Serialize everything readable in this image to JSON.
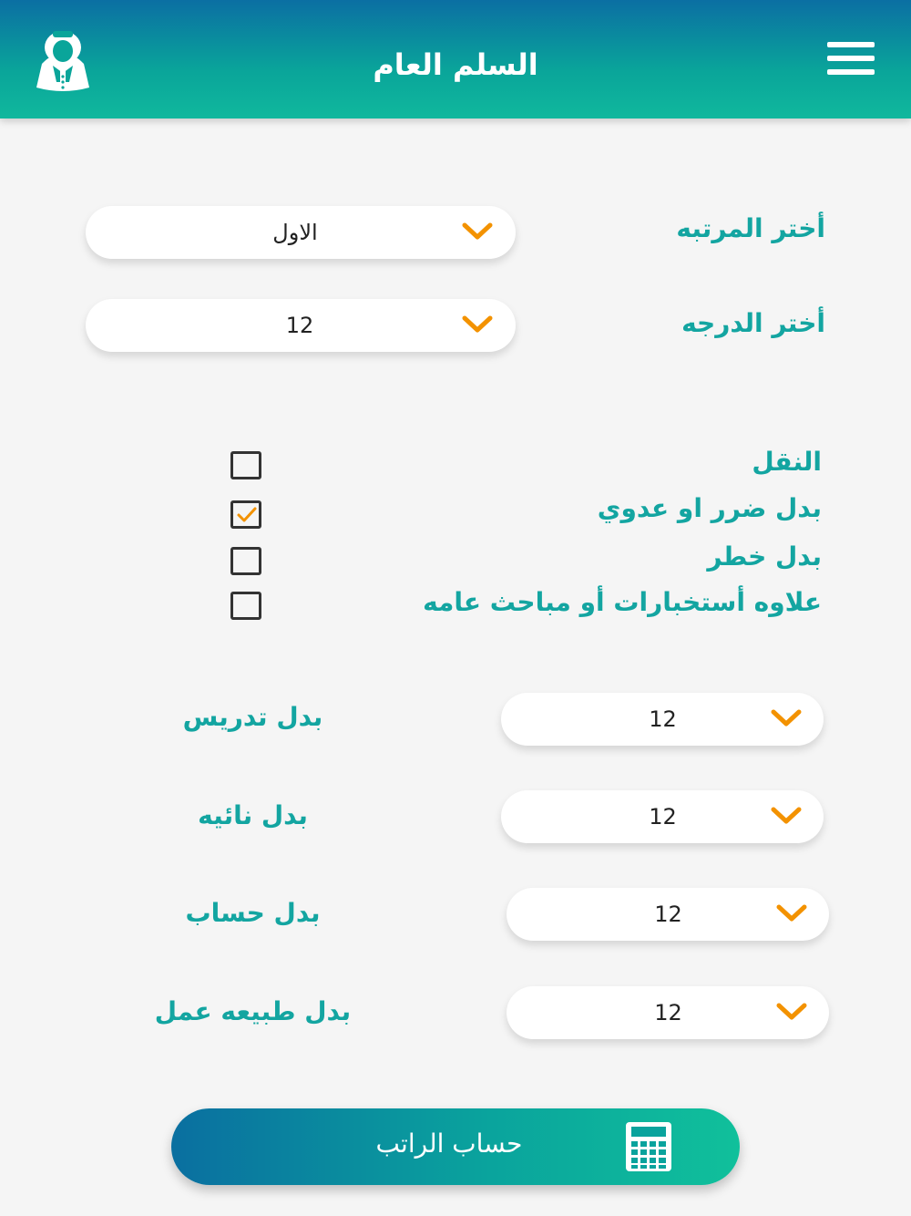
{
  "header": {
    "title": "السلم العام",
    "menu_icon": "hamburger-menu-icon",
    "avatar_icon": "saudi-man-avatar-icon"
  },
  "rank": {
    "label": "أختر المرتبه",
    "value": "الاول"
  },
  "grade": {
    "label": "أختر الدرجه",
    "value": "12"
  },
  "allowances_checks": [
    {
      "label": "النقل",
      "checked": false
    },
    {
      "label": "بدل ضرر او عدوي",
      "checked": true
    },
    {
      "label": "بدل خطر",
      "checked": false
    },
    {
      "label": "علاوه أستخبارات أو مباحث عامه",
      "checked": false
    }
  ],
  "allowances_selects": [
    {
      "label": "بدل تدريس",
      "value": "12"
    },
    {
      "label": "بدل نائيه",
      "value": "12"
    },
    {
      "label": "بدل حساب",
      "value": "12"
    },
    {
      "label": "بدل طبيعه عمل",
      "value": "12"
    }
  ],
  "calculate": {
    "label": "حساب الراتب",
    "icon": "calculator-icon"
  },
  "colors": {
    "accent": "#13a5a1",
    "chevron": "#f39200",
    "header_start": "#0b6fa3",
    "header_end": "#10b89d"
  }
}
